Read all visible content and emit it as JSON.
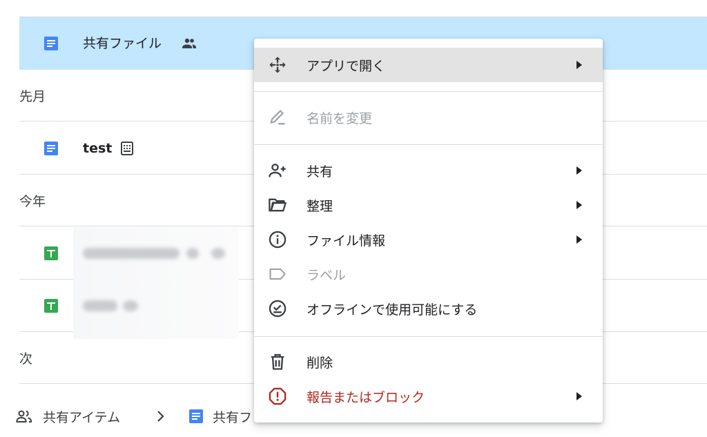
{
  "files": {
    "selected": {
      "name": "共有ファイル",
      "file_icon": "docs-icon",
      "badge_icon": "shared-people-icon"
    },
    "section_last_month": "先月",
    "test_file": {
      "name": "test",
      "file_icon": "docs-icon",
      "badge_icon": "form-template-icon"
    },
    "section_this_year": "今年",
    "sheet_rows": [
      {
        "file_icon": "sheets-icon"
      },
      {
        "file_icon": "sheets-icon"
      }
    ],
    "section_next": "次"
  },
  "breadcrumb": {
    "root_label": "共有アイテム",
    "root_icon": "shared-people-icon",
    "separator_icon": "chevron-right-icon",
    "current_label": "共有フ",
    "current_icon": "docs-icon"
  },
  "context_menu": {
    "open_with": {
      "label": "アプリで開く",
      "icon": "move-arrows-icon",
      "submenu": true
    },
    "rename": {
      "label": "名前を変更",
      "icon": "pencil-icon",
      "disabled": true
    },
    "share": {
      "label": "共有",
      "icon": "person-add-icon",
      "submenu": true
    },
    "organize": {
      "label": "整理",
      "icon": "folder-open-icon",
      "submenu": true
    },
    "file_info": {
      "label": "ファイル情報",
      "icon": "info-icon",
      "submenu": true
    },
    "label": {
      "label": "ラベル",
      "icon": "label-tag-icon",
      "disabled": true
    },
    "offline": {
      "label": "オフラインで使用可能にする",
      "icon": "offline-check-icon"
    },
    "delete": {
      "label": "削除",
      "icon": "trash-icon"
    },
    "report": {
      "label": "報告またはブロック",
      "icon": "report-icon",
      "submenu": true
    }
  },
  "colors": {
    "selected_row": "#c2e7ff",
    "docs_blue": "#4285f4",
    "sheets_green": "#34a853",
    "danger_red": "#b3261e",
    "disabled_gray": "#9aa0a6",
    "hover_gray": "#e3e3e3"
  }
}
